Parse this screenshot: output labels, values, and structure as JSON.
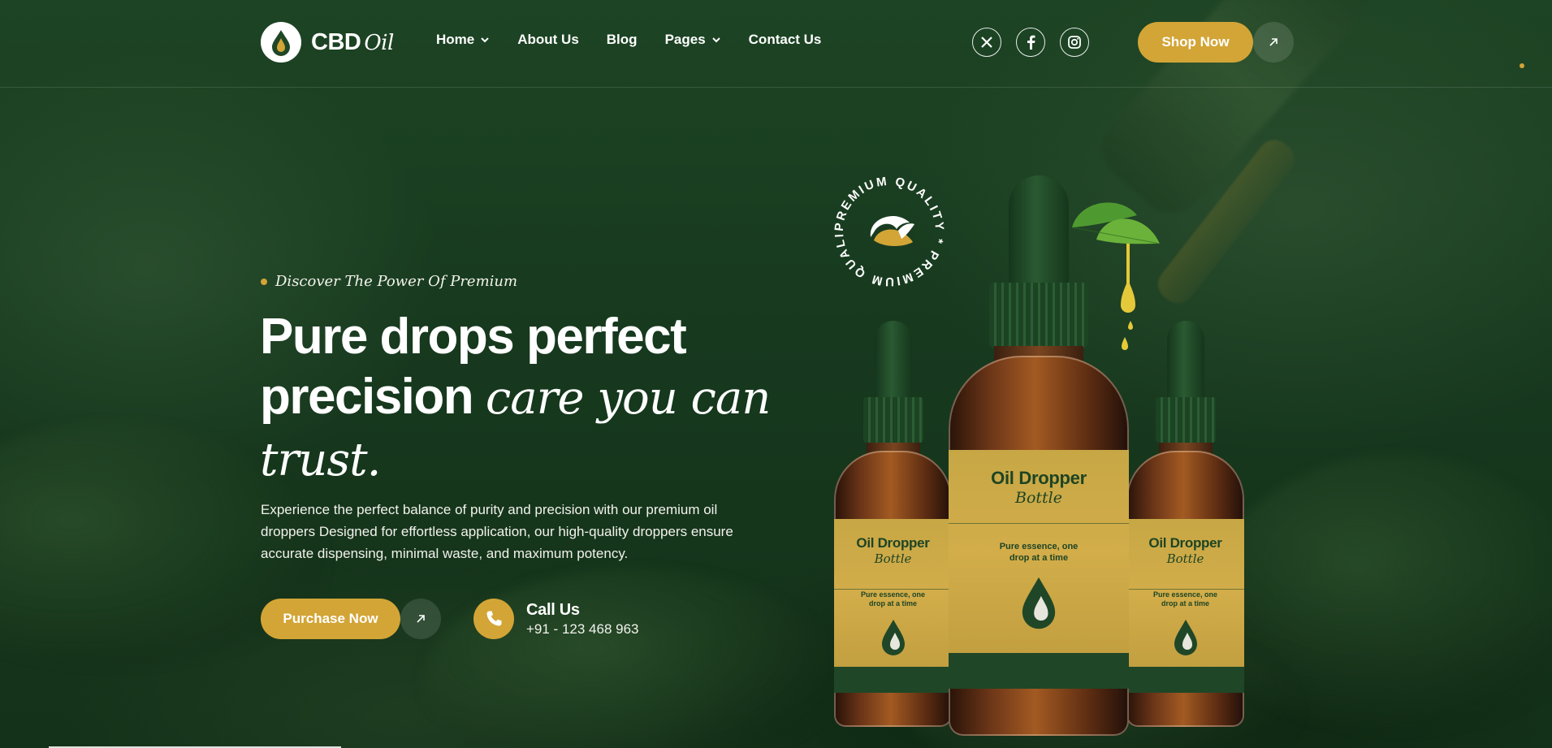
{
  "brand": {
    "name": "CBD",
    "name_italic": "Oil"
  },
  "nav": {
    "items": [
      {
        "label": "Home",
        "has_dropdown": true
      },
      {
        "label": "About Us",
        "has_dropdown": false
      },
      {
        "label": "Blog",
        "has_dropdown": false
      },
      {
        "label": "Pages",
        "has_dropdown": true
      },
      {
        "label": "Contact Us",
        "has_dropdown": false
      }
    ]
  },
  "socials": [
    "x-icon",
    "facebook-icon",
    "instagram-icon"
  ],
  "header": {
    "cta_label": "Shop Now"
  },
  "hero": {
    "tagline": "Discover The Power Of Premium",
    "title_line1": "Pure drops perfect",
    "title_line2_bold": "precision",
    "title_line2_italic": "care you can",
    "title_line3_italic": "trust.",
    "description": "Experience the perfect balance of purity and precision with our premium oil droppers Designed for effortless application, our high-quality droppers ensure accurate dispensing, minimal waste, and maximum potency.",
    "purchase_label": "Purchase Now",
    "call_title": "Call Us",
    "call_number": "+91 - 123 468 963"
  },
  "badge": {
    "text": "PREMIUM QUALITY * PREMIUM QUALITY * "
  },
  "product": {
    "title": "Oil Dropper",
    "subtitle": "Bottle",
    "line1": "Pure essence, one",
    "line2": "drop at a time"
  },
  "colors": {
    "accent": "#d3a536",
    "background": "#17391e",
    "label_gold": "#cba846",
    "label_green": "#1f4727"
  }
}
